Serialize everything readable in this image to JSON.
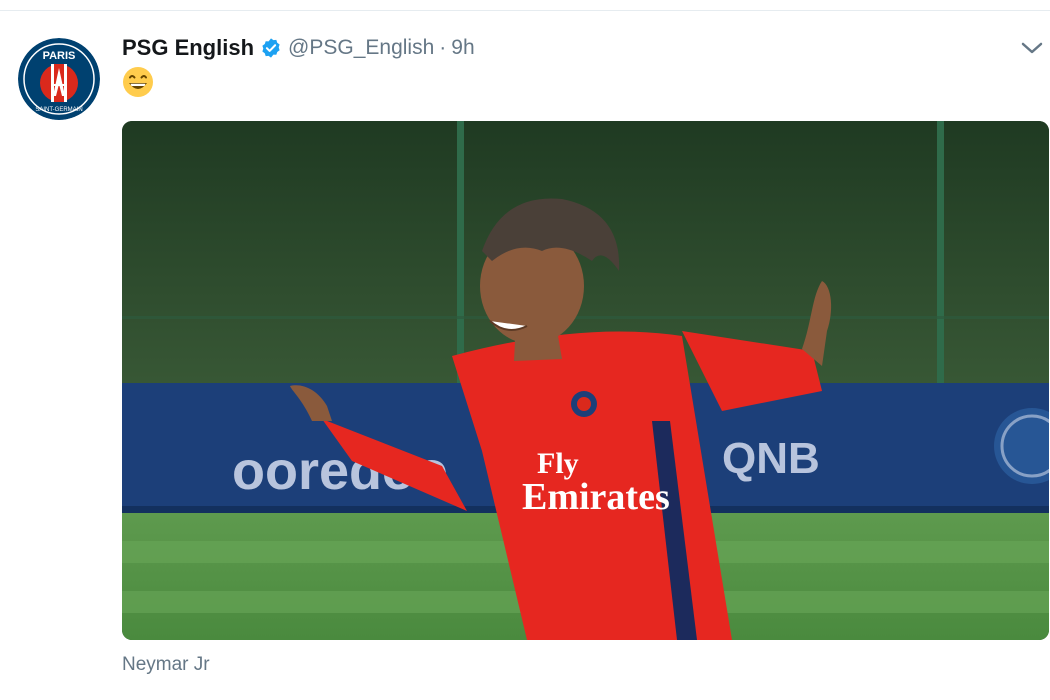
{
  "tweet": {
    "display_name": "PSG English",
    "handle": "@PSG_English",
    "separator": "·",
    "timestamp": "9h",
    "emoji": "😄",
    "verified": true,
    "avatar_icon": "psg-crest-icon",
    "menu_icon": "chevron-down-icon",
    "media_caption": "Neymar Jr",
    "photo_sponsor_lines": [
      "Fly",
      "Emirates"
    ],
    "banner_left": "ooredoo",
    "banner_right": "QNB"
  },
  "colors": {
    "link_blue": "#1da1f2",
    "secondary_text": "#657786",
    "psg_navy": "#004170",
    "psg_red": "#da291c"
  }
}
